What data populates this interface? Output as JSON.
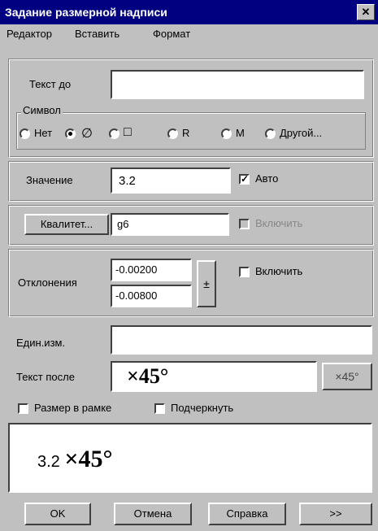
{
  "window": {
    "title": "Задание размерной надписи",
    "close_glyph": "✕"
  },
  "menu": {
    "items": [
      "Редактор",
      "Вставить",
      "Формат"
    ]
  },
  "text_before": {
    "label": "Текст до",
    "value": ""
  },
  "symbol": {
    "group_label": "Символ",
    "options": [
      "Нет",
      "∅",
      "□",
      "R",
      "M",
      "Другой..."
    ],
    "selected": 1
  },
  "value": {
    "label": "Значение",
    "value": "3.2",
    "auto_label": "Авто",
    "auto_checked": true
  },
  "qualitet": {
    "button_label": "Квалитет...",
    "value": "g6",
    "checkbox_label": "Включить",
    "checked": false,
    "enabled": false
  },
  "deviations": {
    "label": "Отклонения",
    "upper": "-0.00200",
    "lower": "-0.00800",
    "pm_label": "±",
    "checkbox_label": "Включить",
    "checked": false
  },
  "units": {
    "label": "Един.изм.",
    "value": ""
  },
  "text_after": {
    "label": "Текст после",
    "value": "×45°",
    "button_label": "×45°"
  },
  "options": {
    "frame_label": "Размер в рамке",
    "underline_label": "Подчеркнуть",
    "frame_checked": false,
    "underline_checked": false
  },
  "preview": {
    "value": "3.2",
    "suffix": "×45°"
  },
  "buttons": {
    "ok": "OK",
    "cancel": "Отмена",
    "help": "Справка",
    "more": ">>"
  }
}
